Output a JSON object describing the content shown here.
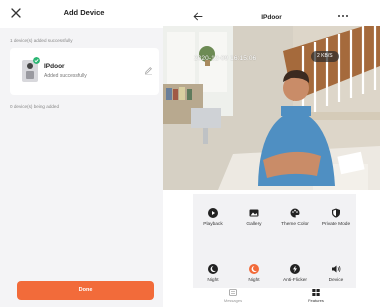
{
  "add_device": {
    "title": "Add Device",
    "section_added": "1 device(s) added successfully",
    "device": {
      "name": "IPdoor",
      "status": "Added successfully"
    },
    "section_being_added": "0 device(s) being added",
    "done_label": "Done",
    "accent_color": "#f26b3a",
    "success_color": "#2bb673"
  },
  "camera": {
    "title": "IPdoor",
    "timestamp": "2020-12-09 16:15:06",
    "bitrate": "2 KB/S",
    "features": [
      {
        "label": "Playback",
        "icon": "playback-icon"
      },
      {
        "label": "Gallery",
        "icon": "gallery-icon"
      },
      {
        "label": "Theme Color",
        "icon": "palette-icon"
      },
      {
        "label": "Private Mode",
        "icon": "shield-icon"
      },
      {
        "label": "Night",
        "icon": "moon-icon"
      },
      {
        "label": "Night",
        "icon": "night-mode-icon"
      },
      {
        "label": "Anti-Flicker",
        "icon": "anti-flicker-icon"
      },
      {
        "label": "Device",
        "icon": "speaker-icon"
      }
    ],
    "tabs": [
      {
        "label": "Messages",
        "icon": "messages-icon"
      },
      {
        "label": "Features",
        "icon": "features-icon"
      }
    ]
  }
}
